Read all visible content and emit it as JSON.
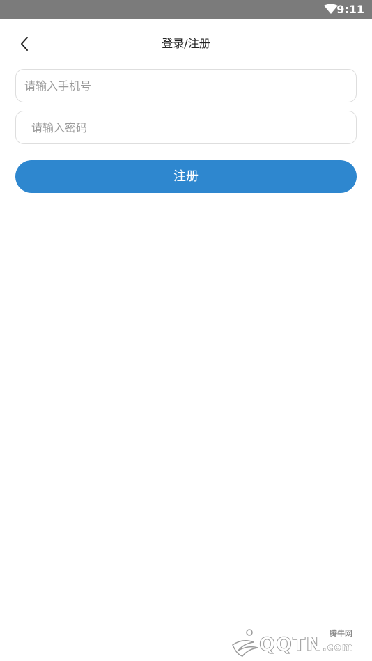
{
  "status_bar": {
    "time": "9:11",
    "wifi_icon": "wifi-icon"
  },
  "nav": {
    "back_icon": "chevron-left-icon",
    "title": "登录/注册"
  },
  "form": {
    "phone_placeholder": "请输入手机号",
    "phone_value": "",
    "password_placeholder": "请输入密码",
    "password_value": "",
    "submit_label": "注册"
  },
  "colors": {
    "status_bar": "#7b7b7b",
    "primary_button": "#2e87cf",
    "field_border": "#dedede",
    "placeholder": "#9a9a9a"
  },
  "watermark": {
    "brand": "腾牛网",
    "domain": "QQTN",
    "domain_suffix": ".com"
  }
}
